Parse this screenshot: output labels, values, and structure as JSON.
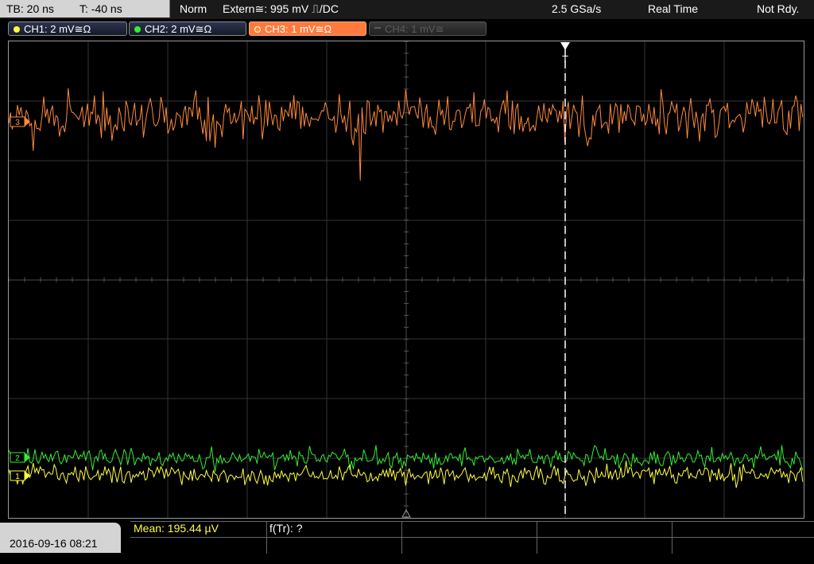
{
  "topbar": {
    "timebase": "TB: 20 ns",
    "trigger_time": "T: -40 ns",
    "trigger_mode": "Norm",
    "trigger_source": "Extern≅: 995 mV ⎍/DC",
    "sample_rate": "2.5 GSa/s",
    "acq_mode": "Real Time",
    "status": "Not Rdy."
  },
  "channels": [
    {
      "label": "CH1: 2 mV≅Ω",
      "color": "#ffff40"
    },
    {
      "label": "CH2: 2 mV≅Ω",
      "color": "#33ee33"
    },
    {
      "label": "CH3: 1 mV≅Ω",
      "color": "#ff8a3c"
    },
    {
      "label": "CH4: 1 mV≅",
      "color": "#5a5a5a"
    }
  ],
  "markers": {
    "trigger": "T",
    "ch1": "1",
    "ch2": "2",
    "ch3": "3"
  },
  "bottom": {
    "datetime": "2016-09-16 08:21",
    "measurement": "Mean: 195.44 µV",
    "freq": "f(Tr): ?"
  }
}
